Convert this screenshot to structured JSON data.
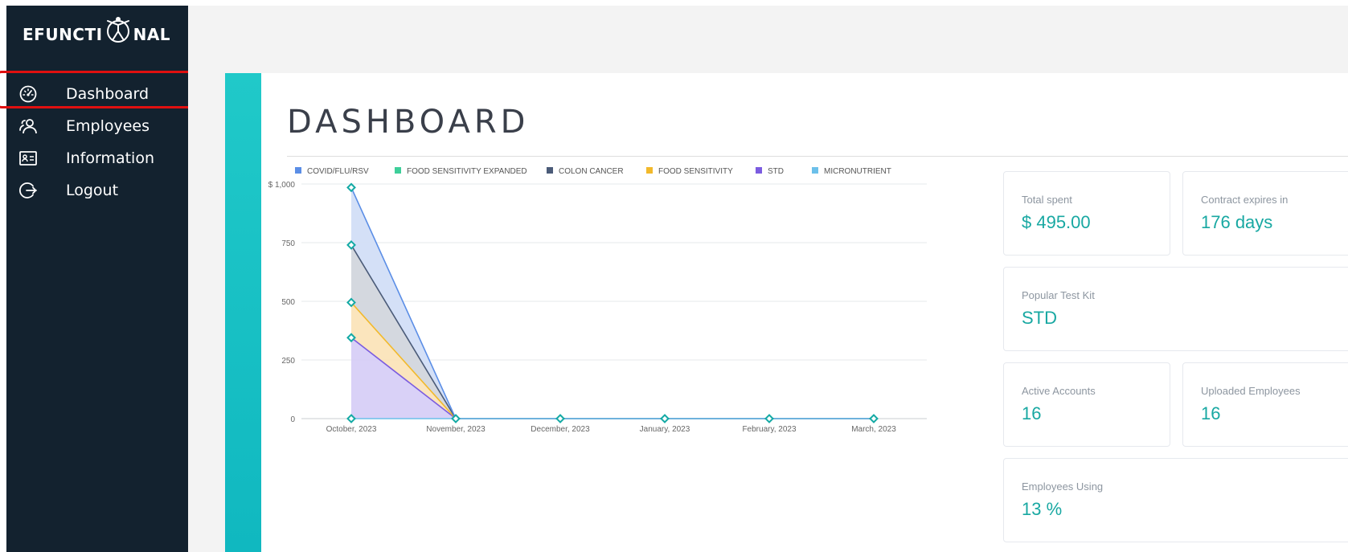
{
  "app": {
    "logo_text_left": "EFUNCTI",
    "logo_text_right": "NAL"
  },
  "sidebar": {
    "items": [
      {
        "label": "Dashboard",
        "icon": "dashboard-gauge-icon",
        "active": true
      },
      {
        "label": "Employees",
        "icon": "users-icon"
      },
      {
        "label": "Information",
        "icon": "id-card-icon"
      },
      {
        "label": "Logout",
        "icon": "logout-icon"
      }
    ]
  },
  "main": {
    "title": "DASHBOARD"
  },
  "cards": {
    "total_spent": {
      "label": "Total spent",
      "value": "$ 495.00"
    },
    "contract": {
      "label": "Contract expires in",
      "value": "176 days"
    },
    "popular": {
      "label": "Popular Test Kit",
      "value": "STD"
    },
    "active": {
      "label": "Active Accounts",
      "value": "16"
    },
    "uploaded": {
      "label": "Uploaded Employees",
      "value": "16"
    },
    "using": {
      "label": "Employees Using",
      "value": "13 %"
    }
  },
  "colors": {
    "sidebar_bg": "#13222f",
    "accent": "#18a8a2",
    "highlight": "#e01010"
  },
  "chart_data": {
    "type": "area",
    "categories": [
      "October, 2023",
      "November, 2023",
      "December, 2023",
      "January, 2023",
      "February, 2023",
      "March, 2023"
    ],
    "ylim": [
      0,
      1000
    ],
    "y_ticks": [
      0,
      250,
      500,
      750,
      1000
    ],
    "y_tick_labels": [
      "0",
      "250",
      "500",
      "750",
      "$ 1,000"
    ],
    "grid": true,
    "legend_position": "top",
    "stacked": true,
    "series": [
      {
        "name": "COVID/FLU/RSV",
        "color": "#5b8ee6",
        "values": [
          0,
          0,
          0,
          0,
          0,
          0
        ]
      },
      {
        "name": "FOOD SENSITIVITY EXPANDED",
        "color": "#3ecf9a",
        "values": [
          0,
          0,
          0,
          0,
          0,
          0
        ]
      },
      {
        "name": "COLON CANCER",
        "color": "#4b5b78",
        "values": [
          245,
          0,
          0,
          0,
          0,
          0
        ]
      },
      {
        "name": "FOOD SENSITIVITY",
        "color": "#f2b92b",
        "values": [
          150,
          0,
          0,
          0,
          0,
          0
        ]
      },
      {
        "name": "STD",
        "color": "#7b5ce0",
        "values": [
          345,
          0,
          0,
          0,
          0,
          0
        ]
      },
      {
        "name": "MICRONUTRIENT",
        "color": "#6cc0ea",
        "values": [
          0,
          0,
          0,
          0,
          0,
          0
        ]
      }
    ],
    "stack_order": [
      "STD",
      "FOOD SENSITIVITY",
      "COLON CANCER",
      "COVID/FLU/RSV"
    ],
    "extra": {
      "COVID/FLU/RSV": [
        245,
        0,
        0,
        0,
        0,
        0
      ]
    }
  }
}
